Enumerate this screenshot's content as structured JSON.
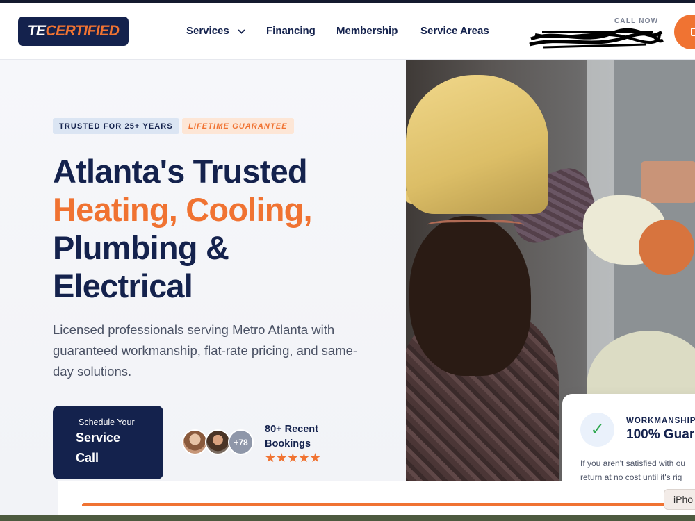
{
  "brand": {
    "logo_part1": "TE",
    "logo_part2": "CERTIFIED",
    "accent_color": "#f07332",
    "navy_color": "#14224d"
  },
  "nav": {
    "items": [
      {
        "label": "Services",
        "has_dropdown": true
      },
      {
        "label": "Financing"
      },
      {
        "label": "Membership"
      },
      {
        "label": "Service Areas"
      }
    ],
    "call_now_label": "CALL NOW"
  },
  "hero": {
    "badge_years": "TRUSTED FOR 25+ YEARS",
    "badge_guarantee": "LIFETIME GUARANTEE",
    "headline_line1": "Atlanta's Trusted",
    "headline_line2": "Heating, Cooling,",
    "headline_line3": "Plumbing &",
    "headline_line4": "Electrical",
    "subtitle": "Licensed professionals serving Metro Atlanta with guaranteed workmanship, flat-rate pricing, and same-day solutions.",
    "cta_small": "Schedule Your",
    "cta_big_line1": "Service",
    "cta_big_line2": "Call",
    "avatar_extra": "+78",
    "bookings_line1": "80+ Recent",
    "bookings_line2": "Bookings",
    "stars": "★★★★★",
    "rating_stars": 5
  },
  "guarantee_card": {
    "label": "WORKMANSHIP",
    "title": "100% Guar",
    "text_line1": "If you aren't satisfied with ou",
    "text_line2": "return at no cost until it's rig",
    "check_icon": "check-icon"
  },
  "overlay": {
    "tooltip_text": "iPho"
  }
}
